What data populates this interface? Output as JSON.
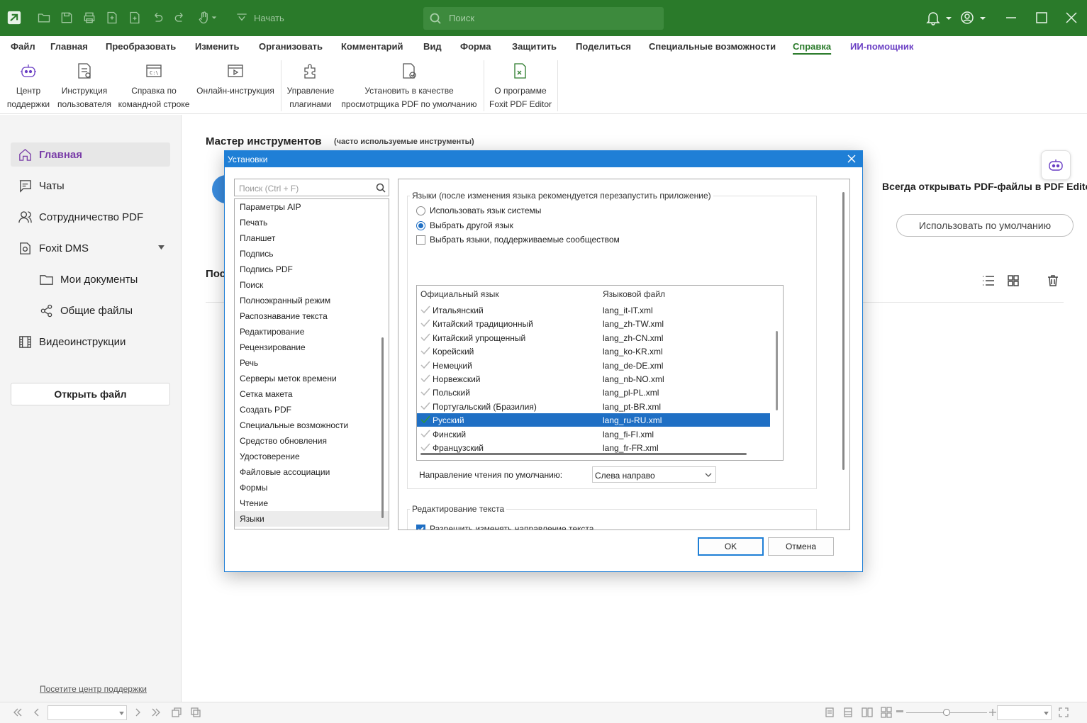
{
  "titlebar": {
    "start_label": "Начать",
    "search_placeholder": "Поиск"
  },
  "ribbon_tabs": [
    "Файл",
    "Главная",
    "Преобразовать",
    "Изменить",
    "Организовать",
    "Комментарий",
    "Вид",
    "Форма",
    "Защитить",
    "Поделиться",
    "Специальные возможности",
    "Справка",
    "ИИ-помощник"
  ],
  "active_tab": "Справка",
  "ribbon": {
    "buttons": [
      {
        "line1": "Центр",
        "line2": "поддержки",
        "icon": "robot-icon"
      },
      {
        "line1": "Инструкция",
        "line2": "пользователя",
        "icon": "user-guide-icon"
      },
      {
        "line1": "Справка по",
        "line2": "командной строке",
        "icon": "command-line-icon"
      },
      {
        "line1": "Онлайн-инструкция",
        "line2": "",
        "icon": "video-icon"
      },
      {
        "line1": "Управление",
        "line2": "плагинами",
        "icon": "plugin-icon"
      },
      {
        "line1": "Установить в качестве",
        "line2": "просмотрщика PDF по умолчанию",
        "icon": "default-viewer-icon"
      },
      {
        "line1": "О программе",
        "line2": "Foxit PDF Editor",
        "icon": "about-icon"
      }
    ]
  },
  "sidebar": {
    "items": [
      {
        "label": "Главная",
        "icon": "home-icon",
        "selected": true
      },
      {
        "label": "Чаты",
        "icon": "chat-icon"
      },
      {
        "label": "Сотрудничество PDF",
        "icon": "collaboration-icon"
      },
      {
        "label": "Foxit DMS",
        "icon": "dms-icon"
      },
      {
        "label": "Мои документы",
        "icon": "folder-icon"
      },
      {
        "label": "Общие файлы",
        "icon": "share-icon"
      },
      {
        "label": "Видеоинструкции",
        "icon": "film-icon"
      }
    ],
    "open_file": "Открыть файл",
    "support_link": "Посетите центр поддержки"
  },
  "main": {
    "master_title": "Мастер инструментов",
    "master_subtitle": "(часто используемые инструменты)",
    "always_open": "Всегда открывать PDF-файлы в PDF Editor",
    "use_default": "Использовать по умолчанию",
    "recent_partial": "Пос"
  },
  "dialog": {
    "title": "Установки",
    "search_placeholder": "Поиск (Ctrl + F)",
    "categories": [
      "Параметры AIP",
      "Печать",
      "Планшет",
      "Подпись",
      "Подпись PDF",
      "Поиск",
      "Полноэкранный режим",
      "Распознавание текста",
      "Редактирование",
      "Рецензирование",
      "Речь",
      "Серверы меток времени",
      "Сетка макета",
      "Создать PDF",
      "Специальные возможности",
      "Средство обновления",
      "Удостоверение",
      "Файловые ассоциации",
      "Формы",
      "Чтение",
      "Языки"
    ],
    "selected_category": "Языки",
    "languages_group": "Языки (после изменения языка рекомендуется перезапустить приложение)",
    "options": {
      "use_system": "Использовать язык системы",
      "choose_other": "Выбрать другой язык",
      "community": "Выбрать языки, поддерживаемые сообществом"
    },
    "table": {
      "col1": "Официальный язык",
      "col2": "Языковой файл",
      "rows": [
        {
          "lang": "Итальянский",
          "file": "lang_it-IT.xml"
        },
        {
          "lang": "Китайский традиционный",
          "file": "lang_zh-TW.xml"
        },
        {
          "lang": "Китайский упрощенный",
          "file": "lang_zh-CN.xml"
        },
        {
          "lang": "Корейский",
          "file": "lang_ko-KR.xml"
        },
        {
          "lang": "Немецкий",
          "file": "lang_de-DE.xml"
        },
        {
          "lang": "Норвежский",
          "file": "lang_nb-NO.xml"
        },
        {
          "lang": "Польский",
          "file": "lang_pl-PL.xml"
        },
        {
          "lang": "Португальский (Бразилия)",
          "file": "lang_pt-BR.xml"
        },
        {
          "lang": "Русский",
          "file": "lang_ru-RU.xml",
          "selected": true
        },
        {
          "lang": "Финский",
          "file": "lang_fi-FI.xml"
        },
        {
          "lang": "Французский",
          "file": "lang_fr-FR.xml"
        }
      ]
    },
    "reading_direction_label": "Направление чтения по умолчанию:",
    "reading_direction_value": "Слева направо",
    "text_edit_group": "Редактирование текста",
    "allow_direction": "Разрешить изменять направление текста",
    "ok": "OK",
    "cancel": "Отмена"
  },
  "colors": {
    "titlebar": "#2a7a2a",
    "accent": "#1f7fd6",
    "sidebar_selected": "#7a3ea8"
  }
}
